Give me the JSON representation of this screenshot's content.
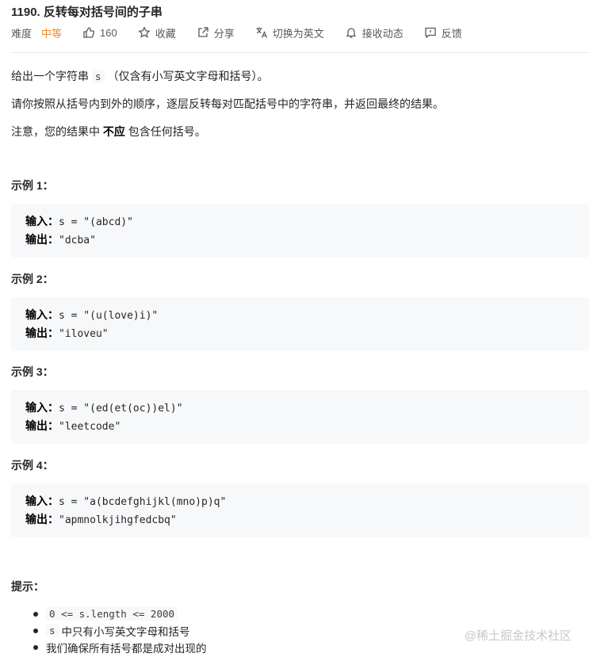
{
  "problem": {
    "title": "1190. 反转每对括号间的子串"
  },
  "meta": {
    "difficulty_label": "难度",
    "difficulty_value": "中等",
    "likes": "160",
    "favorite": "收藏",
    "share": "分享",
    "translate": "切换为英文",
    "notify": "接收动态",
    "feedback": "反馈",
    "difficulty_color": "#ef8c2e"
  },
  "description": {
    "p1_pre": "给出一个字符串",
    "p1_code": "s",
    "p1_post": "（仅含有小写英文字母和括号）。",
    "p2": "请你按照从括号内到外的顺序，逐层反转每对匹配括号中的字符串，并返回最终的结果。",
    "p3_pre": "注意，您的结果中",
    "p3_bold": "不应",
    "p3_post": "包含任何括号。"
  },
  "examples": [
    {
      "title": "示例 1：",
      "input_label": "输入：",
      "input": "s = \"(abcd)\"",
      "output_label": "输出：",
      "output": "\"dcba\""
    },
    {
      "title": "示例 2：",
      "input_label": "输入：",
      "input": "s = \"(u(love)i)\"",
      "output_label": "输出：",
      "output": "\"iloveu\""
    },
    {
      "title": "示例 3：",
      "input_label": "输入：",
      "input": "s = \"(ed(et(oc))el)\"",
      "output_label": "输出：",
      "output": "\"leetcode\""
    },
    {
      "title": "示例 4：",
      "input_label": "输入：",
      "input": "s = \"a(bcdefghijkl(mno)p)q\"",
      "output_label": "输出：",
      "output": "\"apmnolkjihgfedcbq\""
    }
  ],
  "hints": {
    "title": "提示：",
    "h1_code": "0 <= s.length <= 2000",
    "h2_code": "s",
    "h2_text": "中只有小写英文字母和括号",
    "h3_text": "我们确保所有括号都是成对出现的"
  },
  "watermark": "@稀土掘金技术社区"
}
